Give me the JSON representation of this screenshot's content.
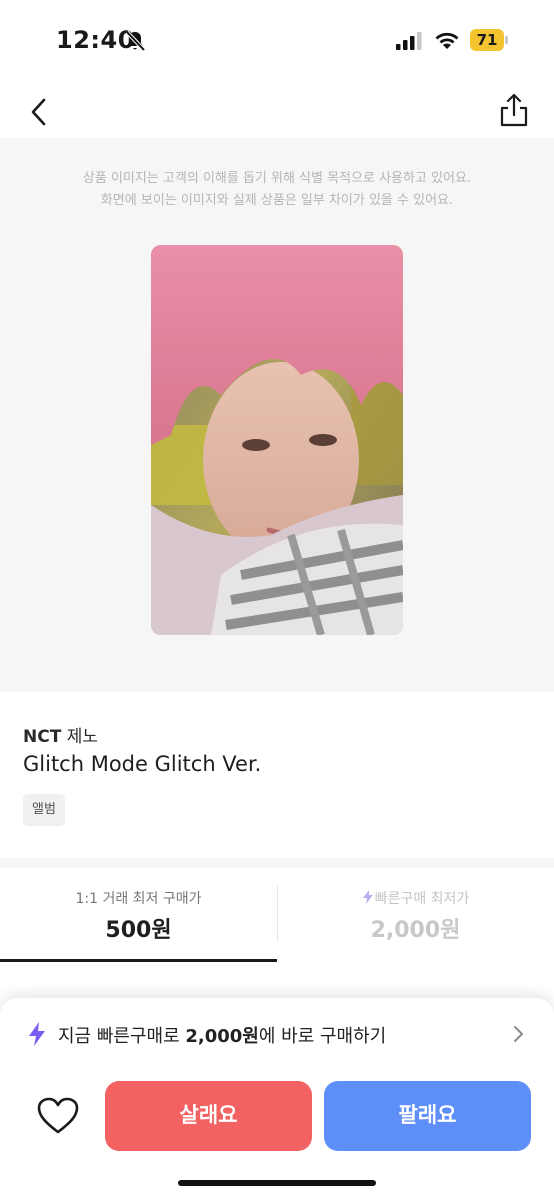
{
  "status_bar": {
    "time": "12:40",
    "battery_level": "71",
    "icons": [
      "bell-slash-icon",
      "cellular-signal-icon",
      "wifi-icon",
      "battery-icon"
    ],
    "battery_color": "#f4c430"
  },
  "nav": {
    "back_icon": "chevron-left-icon",
    "share_icon": "share-icon"
  },
  "image_section": {
    "disclaimer_line1": "상품 이미지는 고객의 이해를 돕기 위해 식별 목적으로 사용하고 있어요.",
    "disclaimer_line2": "화면에 보이는 이미지와 실제 상품은 일부 차이가 있을 수 있어요."
  },
  "product": {
    "artist_group": "NCT",
    "artist_member": "제노",
    "name": "Glitch Mode Glitch Ver.",
    "category": "앨범"
  },
  "price_tabs": [
    {
      "label": "1:1 거래 최저 구매가",
      "price": "500원",
      "selected": true
    },
    {
      "label": "빠른구매 최저가",
      "price": "2,000원",
      "selected": false,
      "icon": "lightning-icon"
    }
  ],
  "quick_buy": {
    "prefix": "지금 빠른구매로 ",
    "price": "2,000원",
    "suffix": "에 바로 구매하기",
    "icon": "lightning-icon"
  },
  "actions": {
    "like_icon": "heart-icon",
    "buy_label": "살래요",
    "sell_label": "팔래요"
  },
  "colors": {
    "buy": "#f26262",
    "sell": "#5e8ef7",
    "lightning": "#7b5cf0"
  }
}
